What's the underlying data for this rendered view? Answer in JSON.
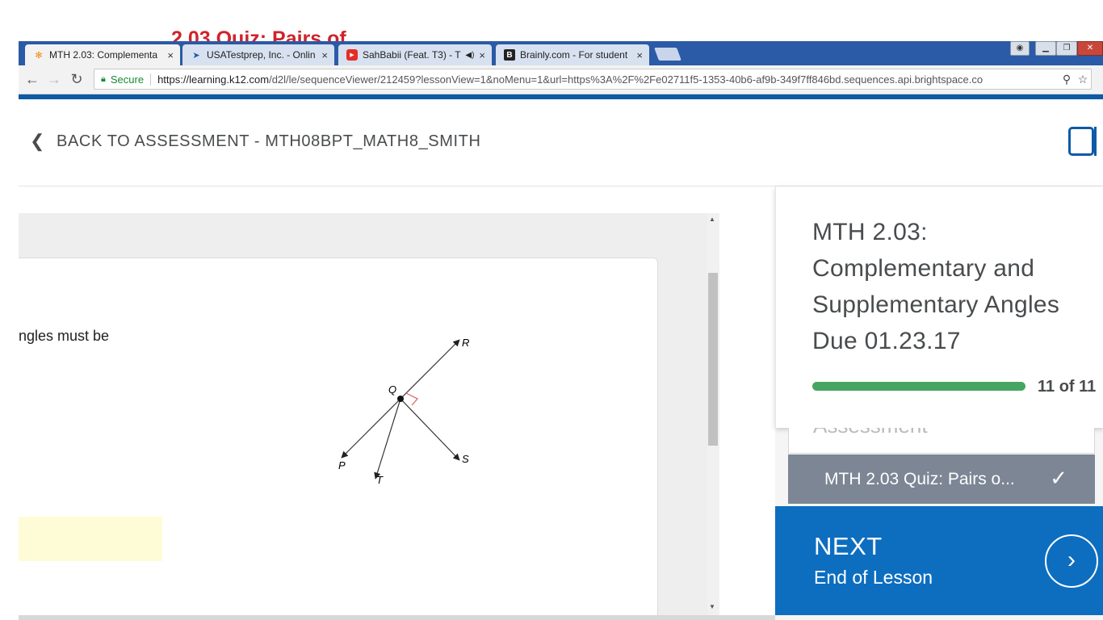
{
  "overlay": {
    "title": "2.03 Quiz: Pairs of"
  },
  "browser": {
    "tabs": [
      {
        "title": "MTH 2.03: Complementa",
        "close": "×"
      },
      {
        "title": "USATestprep, Inc. - Onlin",
        "close": "×"
      },
      {
        "title": "SahBabii (Feat. T3) - T",
        "audio": "◀)",
        "close": "×"
      },
      {
        "title": "Brainly.com - For student",
        "close": "×"
      }
    ],
    "secure_label": "Secure",
    "url_host": "https://learning.k12.com",
    "url_path": "/d2l/le/sequenceViewer/212459?lessonView=1&noMenu=1&url=https%3A%2F%2Fe02711f5-1353-40b6-af9b-349f7ff846bd.sequences.api.brightspace.co"
  },
  "header": {
    "back_label": "BACK TO ASSESSMENT - MTH08BPT_MATH8_SMITH"
  },
  "question": {
    "text_fragment": "ngles must be"
  },
  "diagram": {
    "labels": {
      "r": "R",
      "q": "Q",
      "s": "S",
      "p": "P",
      "t": "T"
    }
  },
  "sidebar": {
    "lesson_title_line1": "MTH 2.03:",
    "lesson_title_line2": "Complementary and",
    "lesson_title_line3": "Supplementary Angles",
    "lesson_title_line4": "Due 01.23.17",
    "progress_text": "11 of 11",
    "progress_fraction": 1.0,
    "assessment_peek": "Assessment",
    "quiz_item": "MTH 2.03 Quiz: Pairs o...",
    "next_label": "NEXT",
    "next_sub": "End of Lesson"
  },
  "colors": {
    "accent_blue": "#0d6ec0",
    "progress_green": "#46a661",
    "overlay_red": "#d0232a"
  }
}
